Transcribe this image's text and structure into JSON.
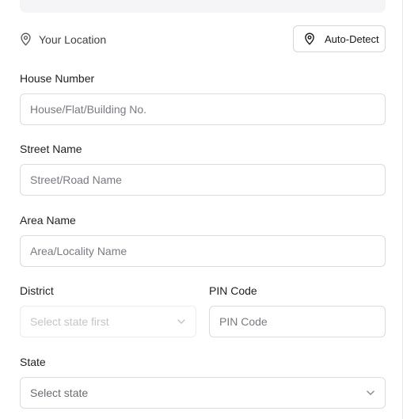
{
  "location": {
    "label": "Your Location",
    "icon": "map-pin-icon",
    "auto_detect_label": "Auto-Detect"
  },
  "form": {
    "house": {
      "label": "House Number",
      "placeholder": "House/Flat/Building No.",
      "value": ""
    },
    "street": {
      "label": "Street Name",
      "placeholder": "Street/Road Name",
      "value": ""
    },
    "area": {
      "label": "Area Name",
      "placeholder": "Area/Locality Name",
      "value": ""
    },
    "district": {
      "label": "District",
      "selected": "Select state first",
      "disabled": true
    },
    "pin": {
      "label": "PIN Code",
      "placeholder": "PIN Code",
      "value": ""
    },
    "state": {
      "label": "State",
      "selected": "Select state"
    }
  },
  "colors": {
    "border": "#dcdce0",
    "placeholder": "#7a7a82",
    "disabled_text": "#c4c4ca",
    "label": "#1f1f23",
    "panel": "#f5f5f7"
  }
}
